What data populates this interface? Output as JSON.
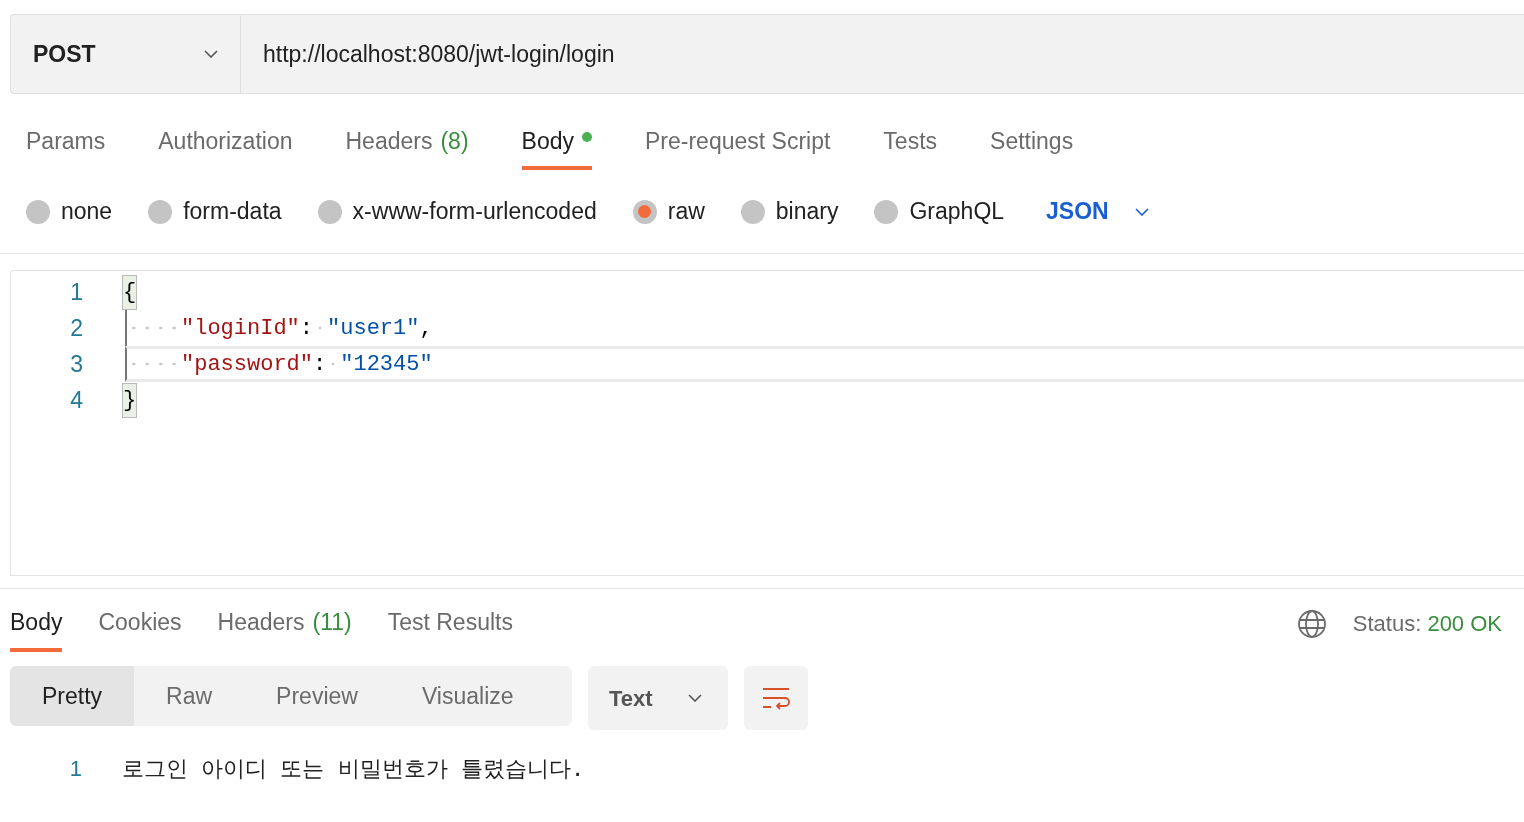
{
  "request": {
    "method": "POST",
    "url": "http://localhost:8080/jwt-login/login"
  },
  "request_tabs": [
    {
      "label": "Params",
      "selected": false,
      "dot": false
    },
    {
      "label": "Authorization",
      "selected": false,
      "dot": false
    },
    {
      "label": "Headers",
      "count": "(8)",
      "selected": false,
      "dot": false
    },
    {
      "label": "Body",
      "selected": true,
      "dot": true
    },
    {
      "label": "Pre-request Script",
      "selected": false,
      "dot": false
    },
    {
      "label": "Tests",
      "selected": false,
      "dot": false
    },
    {
      "label": "Settings",
      "selected": false,
      "dot": false
    }
  ],
  "body_types": [
    {
      "label": "none",
      "selected": false
    },
    {
      "label": "form-data",
      "selected": false
    },
    {
      "label": "x-www-form-urlencoded",
      "selected": false
    },
    {
      "label": "raw",
      "selected": true
    },
    {
      "label": "binary",
      "selected": false
    },
    {
      "label": "GraphQL",
      "selected": false
    }
  ],
  "body_format": "JSON",
  "editor": {
    "lines": [
      {
        "number": "1",
        "indented": false,
        "active": false,
        "tokens": [
          {
            "kind": "brace",
            "text": "{",
            "matched": true
          }
        ]
      },
      {
        "number": "2",
        "indented": true,
        "active": false,
        "tokens": [
          {
            "kind": "key",
            "text": "\"loginId\""
          },
          {
            "kind": "punct",
            "text": ":"
          },
          {
            "kind": "string",
            "text": "\"user1\""
          },
          {
            "kind": "punct",
            "text": ","
          }
        ]
      },
      {
        "number": "3",
        "indented": true,
        "active": true,
        "tokens": [
          {
            "kind": "key",
            "text": "\"password\""
          },
          {
            "kind": "punct",
            "text": ":"
          },
          {
            "kind": "string",
            "text": "\"12345\""
          }
        ]
      },
      {
        "number": "4",
        "indented": false,
        "active": false,
        "tokens": [
          {
            "kind": "brace",
            "text": "}",
            "matched": true
          }
        ]
      }
    ]
  },
  "response_tabs": [
    {
      "label": "Body",
      "selected": true
    },
    {
      "label": "Cookies",
      "selected": false
    },
    {
      "label": "Headers",
      "count": "(11)",
      "selected": false
    },
    {
      "label": "Test Results",
      "selected": false
    }
  ],
  "status": {
    "label": "Status:",
    "value": "200 OK"
  },
  "view_modes": [
    {
      "label": "Pretty",
      "selected": true
    },
    {
      "label": "Raw",
      "selected": false
    },
    {
      "label": "Preview",
      "selected": false
    },
    {
      "label": "Visualize",
      "selected": false
    }
  ],
  "response_format": "Text",
  "response_lines": [
    {
      "number": "1",
      "text": "로그인 아이디 또는 비밀번호가 틀렸습니다."
    }
  ]
}
